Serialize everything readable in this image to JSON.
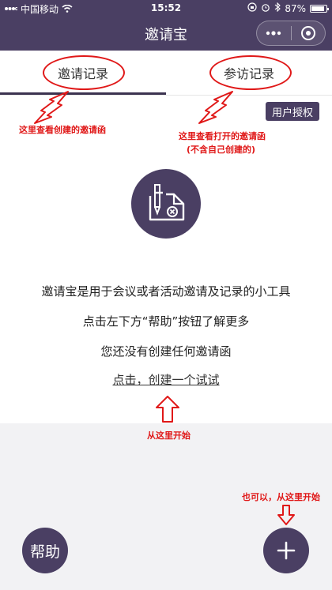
{
  "status_bar": {
    "carrier": "中国移动",
    "time": "15:52",
    "battery": "87%",
    "icons": [
      "signal-icon",
      "wifi-icon",
      "lock-rotation-icon",
      "alarm-icon",
      "bluetooth-icon",
      "battery-icon"
    ]
  },
  "navbar": {
    "title": "邀请宝",
    "menu_icon": "more-dots-icon",
    "close_icon": "target-circle-icon"
  },
  "tabs": [
    {
      "label": "邀请记录",
      "active": true
    },
    {
      "label": "参访记录",
      "active": false
    }
  ],
  "auth_button": {
    "label": "用户授权"
  },
  "annotations": {
    "created": "这里查看创建的邀请函",
    "opened": "这里查看打开的邀请函",
    "opened_note": "(不含自己创建的)",
    "start_here": "从这里开始",
    "also_start": "也可以，从这里开始"
  },
  "empty_state": {
    "line1": "邀请宝是用于会议或者活动邀请及记录的小工具",
    "line2": "点击左下方“帮助”按钮了解更多",
    "line3": "您还没有创建任何邀请函",
    "create_link": "点击，创建一个试试"
  },
  "help_button": {
    "label": "帮助"
  },
  "add_button": {
    "icon": "plus-icon"
  },
  "colors": {
    "primary": "#4a3f63",
    "annotation_red": "#e01818",
    "page_bg": "#f2f2f4"
  }
}
